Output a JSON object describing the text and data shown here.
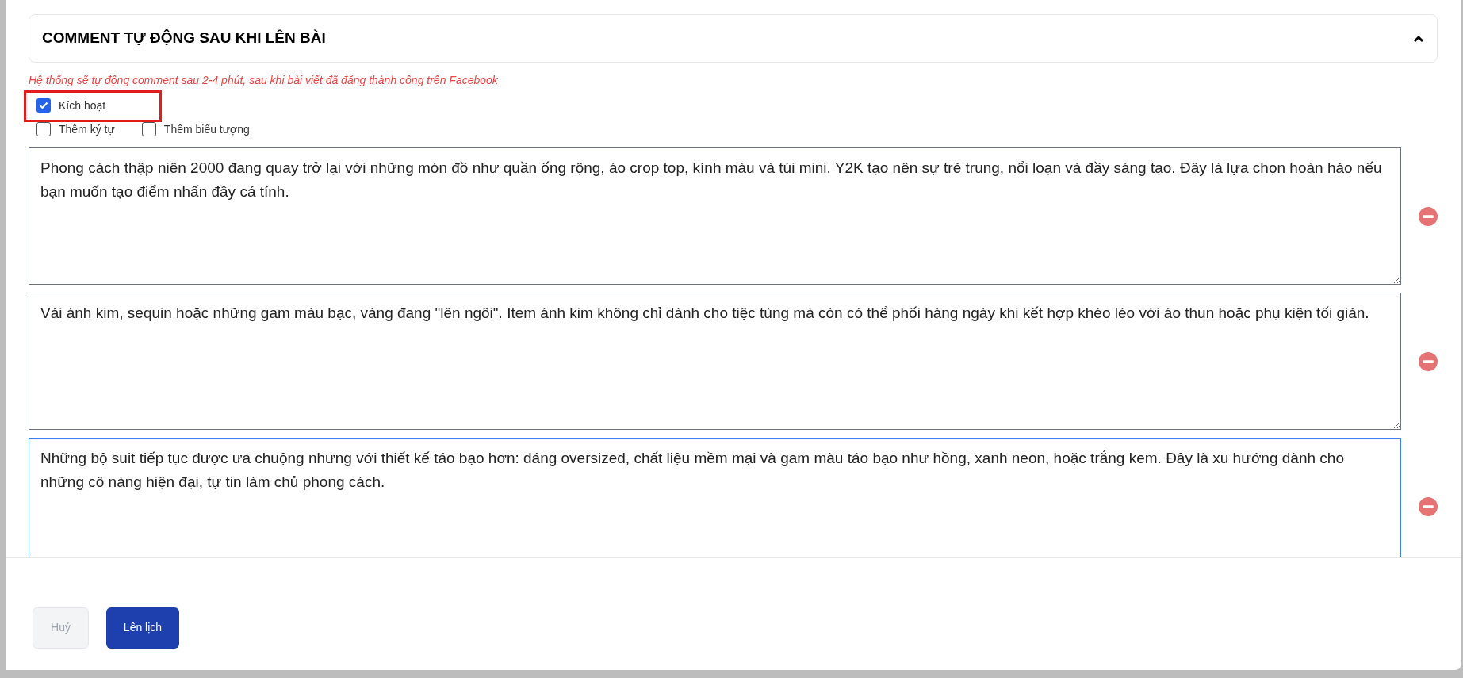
{
  "section": {
    "title": "COMMENT TỰ ĐỘNG SAU KHI LÊN BÀI",
    "expanded": true
  },
  "note": "Hệ thống sẽ tự động comment sau 2-4 phút, sau khi bài viết đã đăng thành công trên Facebook",
  "options": [
    {
      "label": "Kích hoạt",
      "checked": true,
      "highlighted": true
    },
    {
      "label": "Thêm ký tự",
      "checked": false,
      "highlighted": false
    },
    {
      "label": "Thêm biểu tượng",
      "checked": false,
      "highlighted": false
    }
  ],
  "comments": [
    {
      "value": "Phong cách thập niên 2000 đang quay trở lại với những món đồ như quần ống rộng, áo crop top, kính màu và túi mini. Y2K tạo nên sự trẻ trung, nổi loạn và đầy sáng tạo. Đây là lựa chọn hoàn hảo nếu bạn muốn tạo điểm nhấn đầy cá tính.",
      "focused": false
    },
    {
      "value": "Vải ánh kim, sequin hoặc những gam màu bạc, vàng đang \"lên ngôi\". Item ánh kim không chỉ dành cho tiệc tùng mà còn có thể phối hàng ngày khi kết hợp khéo léo với áo thun hoặc phụ kiện tối giản.",
      "focused": false
    },
    {
      "value": "Những bộ suit tiếp tục được ưa chuộng nhưng với thiết kế táo bạo hơn: dáng oversized, chất liệu mềm mại và gam màu táo bạo như hồng, xanh neon, hoặc trắng kem. Đây là xu hướng dành cho những cô nàng hiện đại, tự tin làm chủ phong cách. ",
      "focused": true
    }
  ],
  "buttons": [
    {
      "label": "Huỷ",
      "disabled": true
    },
    {
      "label": "Lên lịch",
      "disabled": false
    }
  ]
}
